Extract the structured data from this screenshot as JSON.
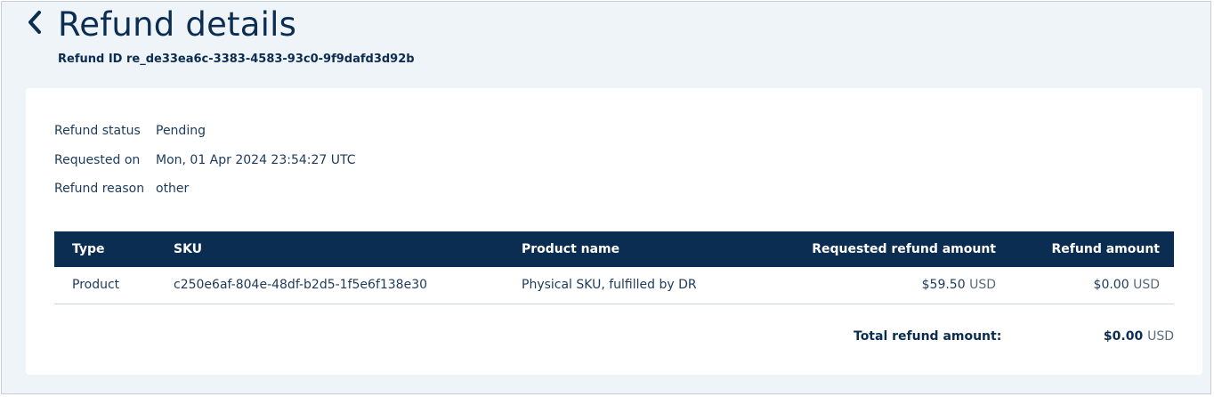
{
  "header": {
    "title": "Refund details",
    "refund_id": "Refund ID re_de33ea6c-3383-4583-93c0-9f9dafd3d92b"
  },
  "info": [
    {
      "label": "Refund status",
      "value": "Pending"
    },
    {
      "label": "Requested on",
      "value": "Mon, 01 Apr 2024 23:54:27 UTC"
    },
    {
      "label": "Refund reason",
      "value": "other"
    }
  ],
  "table": {
    "columns": [
      "Type",
      "SKU",
      "Product name",
      "Requested refund amount",
      "Refund amount"
    ],
    "rows": [
      {
        "type": "Product",
        "sku": "c250e6af-804e-48df-b2d5-1f5e6f138e30",
        "product_name": "Physical SKU, fulfilled by DR",
        "requested_amount": "$59.50",
        "requested_currency": "USD",
        "refund_amount": "$0.00",
        "refund_currency": "USD"
      }
    ]
  },
  "total": {
    "label": "Total refund amount:",
    "amount": "$0.00",
    "currency": "USD"
  },
  "icons": {
    "back": "chevron-left-icon"
  },
  "colors": {
    "header_bg": "#0b2d52",
    "page_bg": "#eff4f8",
    "text": "#0b2d52"
  }
}
